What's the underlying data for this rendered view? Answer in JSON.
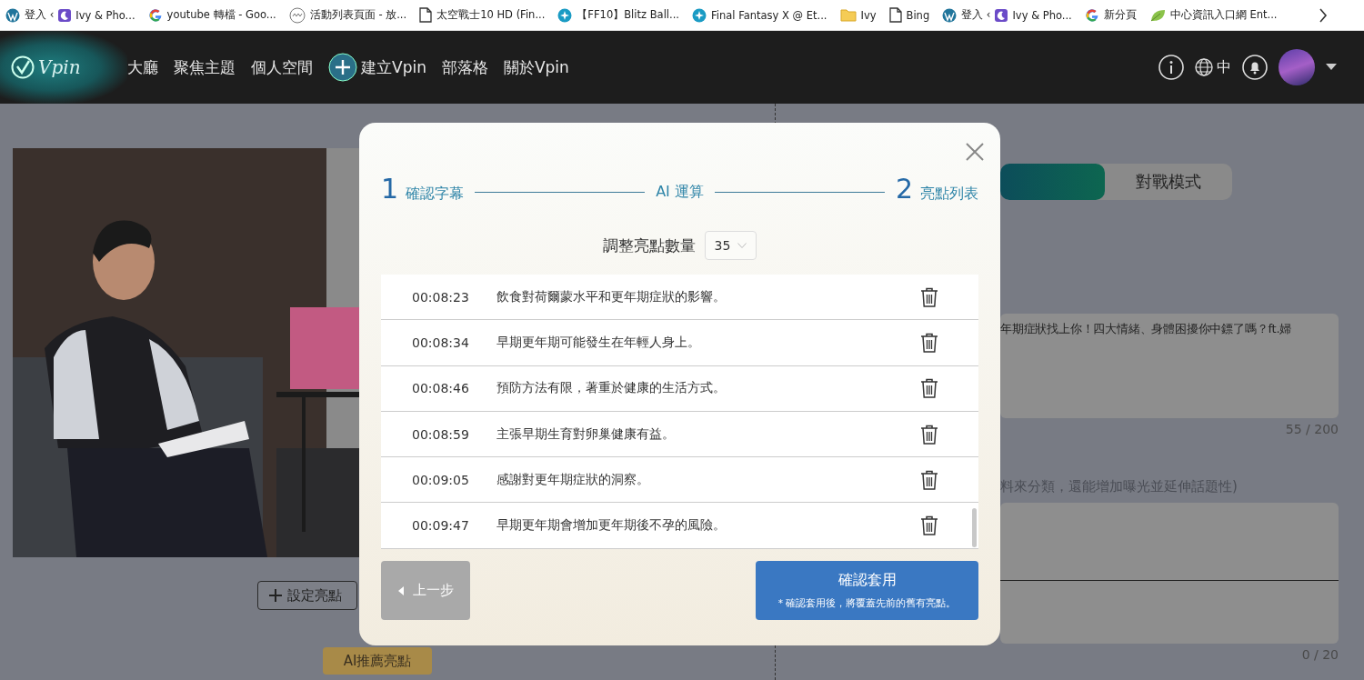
{
  "bookmarks": [
    {
      "kind": "wordpress",
      "label": "登入 ‹",
      "label_2": "Ivy & Pho..."
    },
    {
      "kind": "google",
      "label": "youtube 轉檔 - Goo..."
    },
    {
      "kind": "ring",
      "label": "活動列表頁面 - 放..."
    },
    {
      "kind": "document",
      "label": "太空戰士10 HD (Fin..."
    },
    {
      "kind": "star",
      "label": "【FF10】Blitz Ball..."
    },
    {
      "kind": "star",
      "label": "Final Fantasy X @ Et..."
    },
    {
      "kind": "folder",
      "label": "Ivy"
    },
    {
      "kind": "document",
      "label": "Bing"
    },
    {
      "kind": "wordpress",
      "label": "登入 ‹",
      "label_2": "Ivy & Pho..."
    },
    {
      "kind": "google",
      "label": "新分頁"
    },
    {
      "kind": "leaf",
      "label": "中心資訊入口網 Ent..."
    }
  ],
  "nav": {
    "logo": "Vpin",
    "items": [
      {
        "kind": "link",
        "label": "大廳"
      },
      {
        "kind": "link",
        "label": "聚焦主題"
      },
      {
        "kind": "link",
        "label": "個人空間"
      },
      {
        "kind": "create",
        "label": "建立Vpin"
      },
      {
        "kind": "link",
        "label": "部落格"
      },
      {
        "kind": "link",
        "label": "關於Vpin"
      }
    ],
    "language": "中"
  },
  "editor": {
    "set_highlight_button": "設定亮點",
    "ai_button": "AI推薦亮點",
    "tabs": [
      {
        "selected": true
      },
      {
        "label": "對戰模式",
        "selected": false
      }
    ],
    "title_field": {
      "value": "年期症狀找上你！四大情緒、身體困擾你中鏢了嗎？ft.婦",
      "counter": "55 / 200"
    },
    "tags_hint": "料來分類，還能增加曝光並延伸話題性)",
    "tags_field": {
      "counter": "0 / 20"
    }
  },
  "modal": {
    "steps": [
      {
        "kind": "step",
        "number": "1",
        "label": "確認字幕"
      },
      {
        "kind": "process",
        "label": "AI 運算"
      },
      {
        "kind": "step",
        "number": "2",
        "label": "亮點列表"
      }
    ],
    "count_label": "調整亮點數量",
    "count_value": "35",
    "rows": [
      {
        "time": "00:08:23",
        "text": "飲食對荷爾蒙水平和更年期症狀的影響。"
      },
      {
        "time": "00:08:34",
        "text": "早期更年期可能發生在年輕人身上。"
      },
      {
        "time": "00:08:46",
        "text": "預防方法有限，著重於健康的生活方式。"
      },
      {
        "time": "00:08:59",
        "text": "主張早期生育對卵巢健康有益。"
      },
      {
        "time": "00:09:05",
        "text": "感謝對更年期症狀的洞察。"
      },
      {
        "time": "00:09:47",
        "text": "早期更年期會增加更年期後不孕的風險。"
      }
    ],
    "back_button": "上一步",
    "confirm_button": "確認套用",
    "confirm_note": "* 確認套用後，將覆蓋先前的舊有亮點。"
  }
}
